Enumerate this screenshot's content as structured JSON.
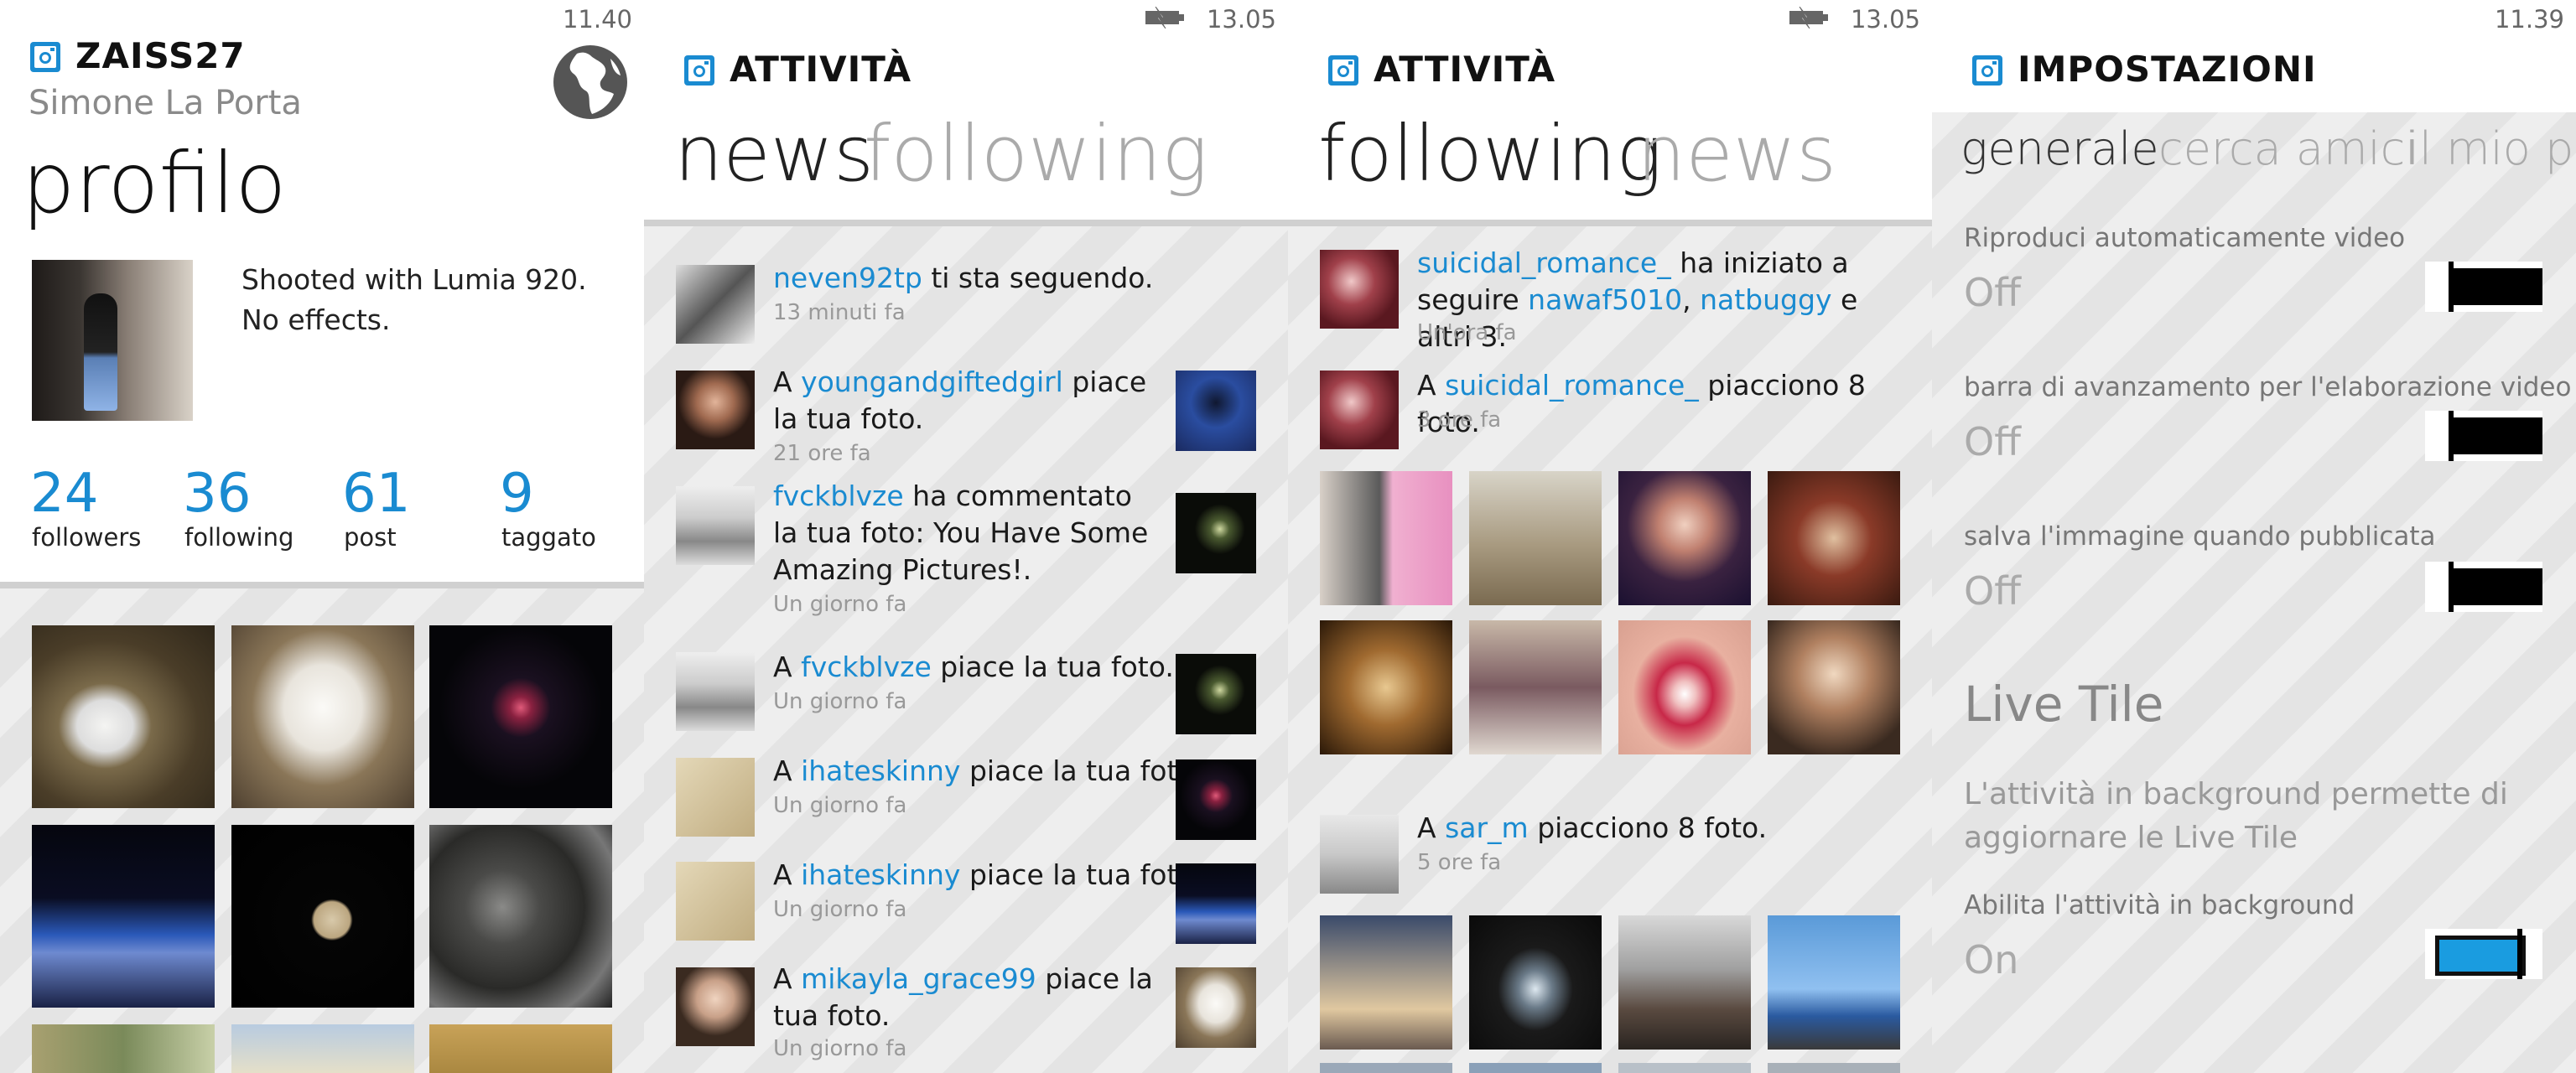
{
  "profile_panel": {
    "time": "11.40",
    "app_title": "ZAISS27",
    "full_name": "Simone La Porta",
    "heading": "profilo",
    "caption_line1": "Shooted with Lumia 920.",
    "caption_line2": "No effects.",
    "stats": [
      {
        "num": "24",
        "label": "followers"
      },
      {
        "num": "36",
        "label": "following"
      },
      {
        "num": "61",
        "label": "post"
      },
      {
        "num": "9",
        "label": "taggato"
      }
    ]
  },
  "news_panel": {
    "time": "13.05",
    "app_title": "ATTIVITÀ",
    "pivot_active": "news",
    "pivot_other": "following",
    "items": [
      {
        "pre": "",
        "user": "neven92tp",
        "post": " ti sta seguendo.",
        "time": "13 minuti fa"
      },
      {
        "pre": "A ",
        "user": "youngandgiftedgirl",
        "post": " piace la tua foto.",
        "time": "21 ore fa"
      },
      {
        "pre": "",
        "user": "fvckblvze",
        "post": " ha commentato la tua foto: You Have Some Amazing Pictures!.",
        "time": "Un giorno fa"
      },
      {
        "pre": "A ",
        "user": "fvckblvze",
        "post": " piace la tua foto.",
        "time": "Un giorno fa"
      },
      {
        "pre": "A ",
        "user": "ihateskinny",
        "post": " piace la tua foto.",
        "time": "Un giorno fa"
      },
      {
        "pre": "A ",
        "user": "ihateskinny",
        "post": " piace la tua foto.",
        "time": "Un giorno fa"
      },
      {
        "pre": "A ",
        "user": "mikayla_grace99",
        "post": " piace la tua foto.",
        "time": "Un giorno fa"
      }
    ]
  },
  "following_panel": {
    "time": "13.05",
    "app_title": "ATTIVITÀ",
    "pivot_active": "following",
    "pivot_other": "news",
    "item1": {
      "user": "suicidal_romance_",
      "mid": " ha iniziato a seguire ",
      "user2": "nawaf5010",
      "sep": ", ",
      "user3": "natbuggy",
      "post": " e altri 3.",
      "time": "Un'ora fa"
    },
    "item2": {
      "pre": "A ",
      "user": "suicidal_romance_",
      "post": " piacciono 8 foto.",
      "time": "3 ore fa"
    },
    "item3": {
      "pre": "A ",
      "user": "sar_m",
      "post": " piacciono 8 foto.",
      "time": "5 ore fa"
    }
  },
  "settings_panel": {
    "time": "11.39",
    "app_title": "IMPOSTAZIONI",
    "pivot_active": "generale",
    "pivot_other1": "cerca amici",
    "pivot_other2": "il mio pro",
    "settings": [
      {
        "label": "Riproduci automaticamente video",
        "value": "Off"
      },
      {
        "label": "barra di avanzamento per l'elaborazione video",
        "value": "Off"
      },
      {
        "label": "salva l'immagine quando pubblicata",
        "value": "Off"
      }
    ],
    "live_tile_heading": "Live Tile",
    "live_tile_desc_line1": "L'attività in background permette di",
    "live_tile_desc_line2": "aggiornare le Live Tile",
    "background_label": "Abilita l'attività in background",
    "background_value": "On"
  },
  "colors": {
    "accent": "#1a8bd1",
    "toggle_on": "#1a9ce0"
  }
}
